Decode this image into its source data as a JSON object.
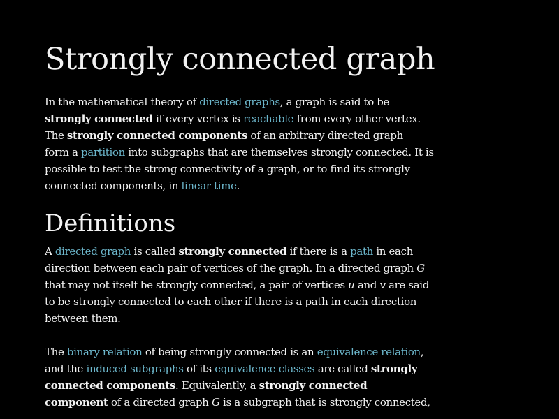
{
  "article": {
    "title": "Strongly connected graph",
    "intro": {
      "l1_a": "In the mathematical theory of ",
      "l1_link": "directed graphs",
      "l1_b": ", a graph is said to be",
      "l2_bold": "strongly connected",
      "l2_a": " if every vertex is ",
      "l2_link": "reachable",
      "l2_b": " from every other vertex.",
      "l3_a": "The ",
      "l3_bold": "strongly connected components",
      "l3_b": " of an arbitrary directed graph",
      "l4_a": "form a ",
      "l4_link": "partition",
      "l4_b": " into subgraphs that are themselves strongly connected. It is",
      "l5": "possible to test the strong connectivity of a graph, or to find its strongly",
      "l6_a": "connected components, in ",
      "l6_link": "linear time",
      "l6_b": "."
    },
    "definitions": {
      "heading": "Definitions",
      "p1": {
        "l1_a": "A ",
        "l1_link": "directed graph",
        "l1_b": " is called ",
        "l1_bold": "strongly connected",
        "l1_c": " if there is a ",
        "l1_link2": "path",
        "l1_d": " in each",
        "l2": "direction between each pair of vertices of the graph. In a directed graph ",
        "l2_var": "G",
        "l3_a": "that may not itself be strongly connected, a pair of vertices ",
        "l3_var1": "u",
        "l3_b": " and ",
        "l3_var2": "v",
        "l3_c": " are said",
        "l4": "to be strongly connected to each other if there is a path in each direction",
        "l5": "between them."
      },
      "p2": {
        "l1_a": "The ",
        "l1_link": "binary relation",
        "l1_b": " of being strongly connected is an ",
        "l1_link2": "equivalence relation",
        "l1_c": ",",
        "l2_a": "and the ",
        "l2_link": "induced subgraphs",
        "l2_b": " of its ",
        "l2_link2": "equivalence classes",
        "l2_c": " are called ",
        "l2_bold": "strongly",
        "l3_bold": "connected components",
        "l3_a": ". Equivalently, a ",
        "l3_bold2": "strongly connected",
        "l4_bold": "component",
        "l4_a": " of a directed graph ",
        "l4_var": "G",
        "l4_b": " is a subgraph that is strongly connected,"
      }
    }
  },
  "colors": {
    "background": "#000000",
    "text": "#f2f2f2",
    "link": "#6cb6cb"
  }
}
